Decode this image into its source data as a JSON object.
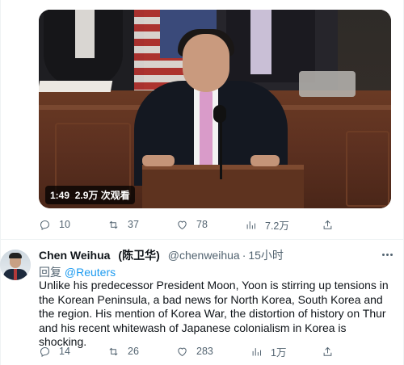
{
  "video": {
    "duration": "1:49",
    "views": "2.9万 次观看"
  },
  "main_tweet_actions": {
    "replies": "10",
    "retweets": "37",
    "likes": "78",
    "views": "7.2万"
  },
  "reply": {
    "display_name": "Chen Weihua",
    "display_name_cn": "(陈卫华)",
    "handle": "@chenweihua",
    "separator": "·",
    "time": "15小时",
    "reply_prefix": "回复",
    "reply_to": "@Reuters",
    "text": "Unlike his predecessor President Moon, Yoon is stirring up tensions in the Korean Peninsula, a bad news for North Korea, South Korea and the region. His mention of Korea War, the distortion of history on Thur and his recent whitewash of Japanese colonialism in Korea is shocking.",
    "actions": {
      "replies": "14",
      "retweets": "26",
      "likes": "283",
      "views": "1万"
    }
  },
  "colors": {
    "text_primary": "#0f1419",
    "text_secondary": "#536471",
    "link": "#1d9bf0",
    "divider": "#eff3f4"
  }
}
